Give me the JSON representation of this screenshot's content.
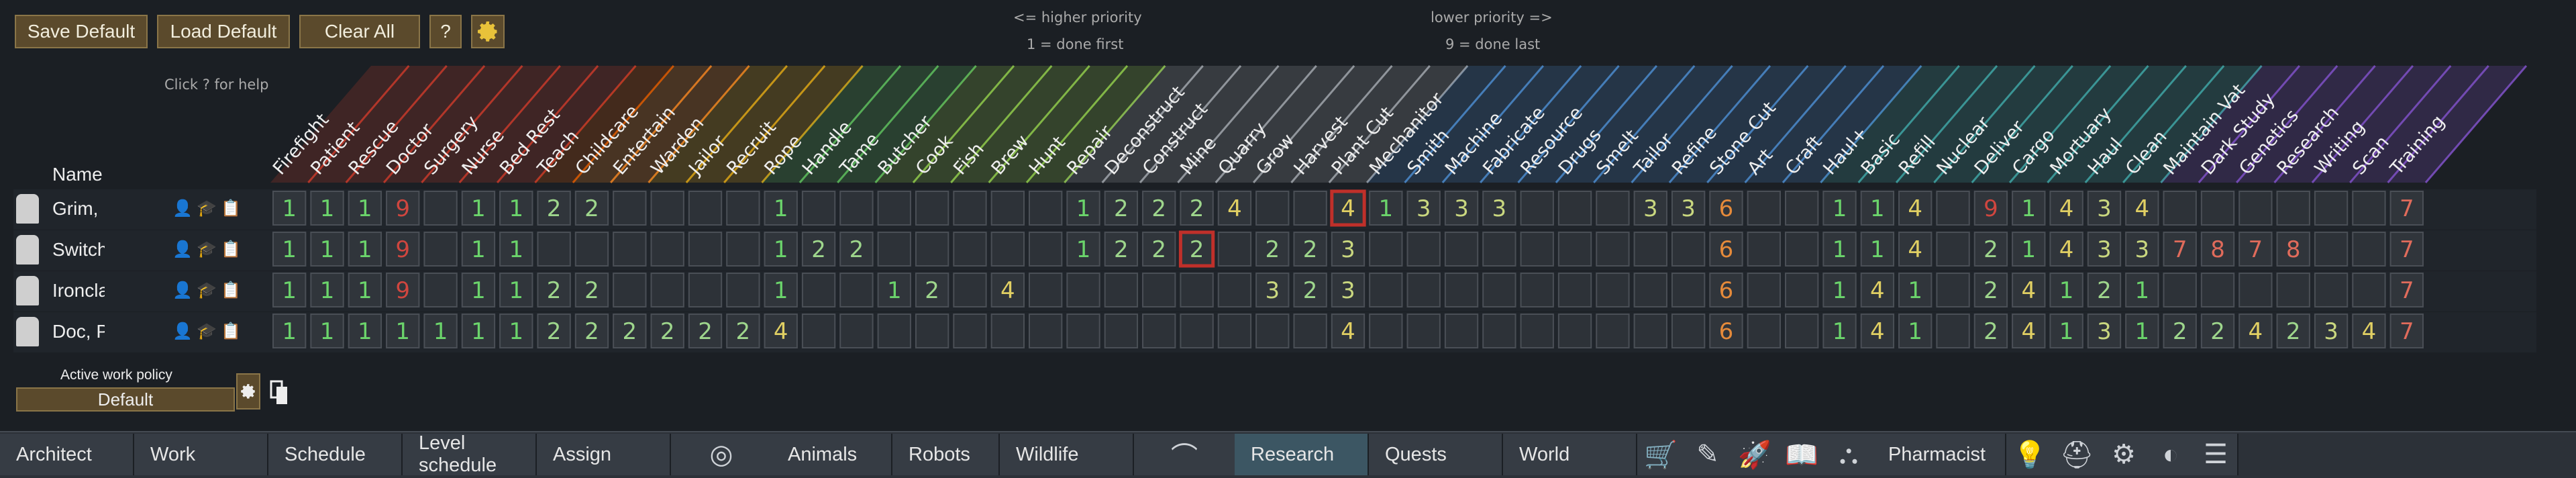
{
  "toolbar": {
    "save_default": "Save Default",
    "load_default": "Load Default",
    "clear_all": "Clear All",
    "help": "?",
    "settings_icon": "gear-icon"
  },
  "hints": {
    "higher_priority": "<= higher priority",
    "done_first": "1 = done first",
    "lower_priority": "lower priority =>",
    "done_last": "9 = done last",
    "click_help": "Click ? for help"
  },
  "table": {
    "name_header": "Name",
    "columns": [
      "Firefight",
      "Patient",
      "Rescue",
      "Doctor",
      "Surgery",
      "Nurse",
      "Bed Rest",
      "Teach",
      "Childcare",
      "Entertain",
      "Warden",
      "Jailor",
      "Recruit",
      "Rope",
      "Handle",
      "Tame",
      "Butcher",
      "Cook",
      "Fish",
      "Brew",
      "Hunt",
      "Repair",
      "Deconstruct",
      "Construct",
      "Mine",
      "Quarry",
      "Grow",
      "Harvest",
      "Plant Cut",
      "Mechanitor",
      "Smith",
      "Machine",
      "Fabricate",
      "Resource",
      "Drugs",
      "Smelt",
      "Tailor",
      "Refine",
      "Stone Cut",
      "Art",
      "Craft",
      "Haul+",
      "Basic",
      "Refill",
      "Nuclear",
      "Deliver",
      "Cargo",
      "Mortuary",
      "Haul",
      "Clean",
      "Maintain Vat",
      "Dark Study",
      "Genetics",
      "Research",
      "Writing",
      "Scan",
      "Training"
    ],
    "column_colors": [
      "#c0392b",
      "#c0392b",
      "#c0392b",
      "#c0392b",
      "#c0392b",
      "#c0392b",
      "#c0392b",
      "#d35400",
      "#e67e22",
      "#e67e22",
      "#d4a017",
      "#d4a017",
      "#d4a017",
      "#5cb85c",
      "#5cb85c",
      "#5cb85c",
      "#8bc34a",
      "#8bc34a",
      "#8bc34a",
      "#8bc34a",
      "#8bc34a",
      "#9aa0a6",
      "#9aa0a6",
      "#9aa0a6",
      "#9aa0a6",
      "#9aa0a6",
      "#9aa0a6",
      "#9aa0a6",
      "#9aa0a6",
      "#4a86c5",
      "#4a86c5",
      "#4a86c5",
      "#4a86c5",
      "#4a86c5",
      "#4a86c5",
      "#4a86c5",
      "#4a86c5",
      "#4a86c5",
      "#4a86c5",
      "#4a86c5",
      "#4a86c5",
      "#3ea0a0",
      "#3ea0a0",
      "#3ea0a0",
      "#3ea0a0",
      "#3ea0a0",
      "#3ea0a0",
      "#3ea0a0",
      "#3ea0a0",
      "#3ea0a0",
      "#7b4fc0",
      "#7b4fc0",
      "#7b4fc0",
      "#7b4fc0",
      "#7b4fc0",
      "#7b4fc0",
      "#7b4fc0"
    ],
    "rows": [
      {
        "name": "Grim, I",
        "cells": [
          "1",
          "1",
          "1",
          "9",
          "",
          "1",
          "1",
          "2",
          "2",
          "",
          "",
          "",
          "",
          "1",
          "",
          "",
          "",
          "",
          "",
          "",
          "",
          "1",
          "2",
          "2",
          "2",
          "4",
          "",
          "",
          "4",
          "1",
          "3",
          "3",
          "3",
          "",
          "",
          "",
          "3",
          "3",
          "6",
          "",
          "",
          "1",
          "1",
          "4",
          "",
          "9",
          "1",
          "4",
          "3",
          "4",
          "",
          "",
          "",
          "",
          "",
          "",
          "7"
        ],
        "marked": [
          28
        ]
      },
      {
        "name": "Switch",
        "cells": [
          "1",
          "1",
          "1",
          "9",
          "",
          "1",
          "1",
          "",
          "",
          "",
          "",
          "",
          "",
          "1",
          "2",
          "2",
          "",
          "",
          "",
          "",
          "",
          "1",
          "2",
          "2",
          "2",
          "",
          "2",
          "2",
          "3",
          "",
          "",
          "",
          "",
          "",
          "",
          "",
          "",
          "",
          "6",
          "",
          "",
          "1",
          "1",
          "4",
          "",
          "2",
          "1",
          "4",
          "3",
          "3",
          "7",
          "8",
          "7",
          "8",
          "",
          "",
          "7"
        ],
        "marked": [
          24
        ]
      },
      {
        "name": "Ironcla",
        "cells": [
          "1",
          "1",
          "1",
          "9",
          "",
          "1",
          "1",
          "2",
          "2",
          "",
          "",
          "",
          "",
          "1",
          "",
          "",
          "1",
          "2",
          "",
          "4",
          "",
          "",
          "",
          "",
          "",
          "",
          "3",
          "2",
          "3",
          "",
          "",
          "",
          "",
          "",
          "",
          "",
          "",
          "",
          "6",
          "",
          "",
          "1",
          "4",
          "1",
          "",
          "2",
          "4",
          "1",
          "2",
          "1",
          "",
          "",
          "",
          "",
          "",
          "",
          "7"
        ],
        "marked": []
      },
      {
        "name": "Doc, P",
        "cells": [
          "1",
          "1",
          "1",
          "1",
          "1",
          "1",
          "1",
          "2",
          "2",
          "2",
          "2",
          "2",
          "2",
          "4",
          "",
          "",
          "",
          "",
          "",
          "",
          "",
          "",
          "",
          "",
          "",
          "",
          "",
          "",
          "4",
          "",
          "",
          "",
          "",
          "",
          "",
          "",
          "",
          "",
          "6",
          "",
          "",
          "1",
          "4",
          "1",
          "",
          "2",
          "4",
          "1",
          "3",
          "1",
          "2",
          "2",
          "4",
          "2",
          "3",
          "4",
          "7"
        ],
        "marked": []
      }
    ],
    "row_icons": [
      "assign-icon",
      "work-icon",
      "clipboard-icon"
    ]
  },
  "policy": {
    "label": "Active work policy",
    "value": "Default"
  },
  "colors": {
    "p1": "#6bd46b",
    "p2": "#9ed68c",
    "p3": "#c9d77f",
    "p4": "#e0cf63",
    "p6": "#e58a3a",
    "p7": "#e06b5b",
    "p8": "#e06b5b",
    "p9": "#d0463f",
    "marker": "#c0302a"
  },
  "bottom_tabs": [
    {
      "label": "Architect"
    },
    {
      "label": "Work"
    },
    {
      "label": "Schedule"
    },
    {
      "label": "Level schedule"
    },
    {
      "label": "Assign"
    },
    {
      "label": "",
      "icon": "ideology-icon"
    },
    {
      "label": "Animals"
    },
    {
      "label": "Robots"
    },
    {
      "label": "Wildlife"
    },
    {
      "label": "",
      "icon": "dish-icon"
    },
    {
      "label": "Research",
      "active": true
    },
    {
      "label": "Quests"
    },
    {
      "label": "World"
    },
    {
      "label": "",
      "icon": "cart-icon"
    },
    {
      "label": "",
      "icon": "feather-icon"
    },
    {
      "label": "",
      "icon": "rocket-icon"
    },
    {
      "label": "",
      "icon": "book-icon"
    },
    {
      "label": "",
      "icon": "factions-icon"
    },
    {
      "label": "Pharmacist"
    },
    {
      "label": "",
      "icon": "lightbulb-icon"
    },
    {
      "label": "",
      "icon": "helmet-icon"
    },
    {
      "label": "",
      "icon": "settings-list-icon"
    },
    {
      "label": "",
      "icon": "mech-icon"
    },
    {
      "label": "",
      "icon": "menu-icon"
    }
  ]
}
